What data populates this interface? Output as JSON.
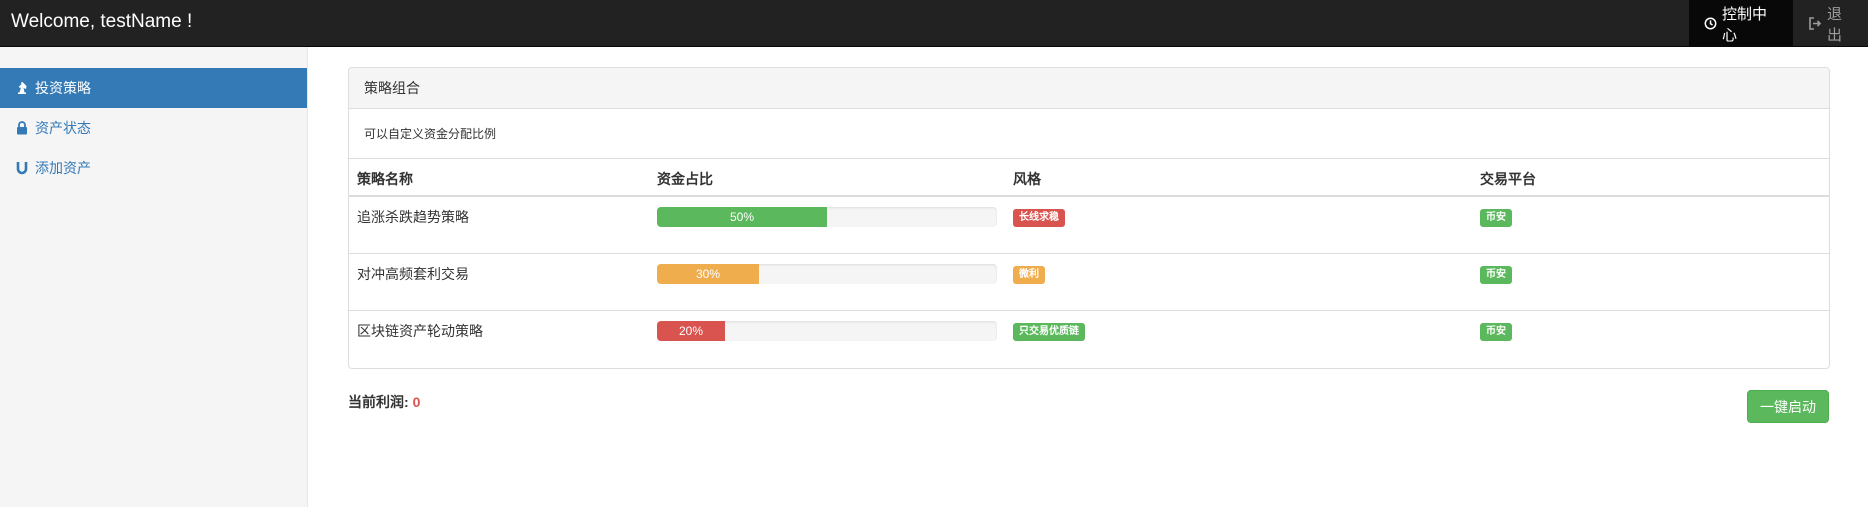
{
  "header": {
    "brand": "Welcome, testName !",
    "nav": [
      {
        "label": "控制中心",
        "icon": "dashboard-icon",
        "active": true
      },
      {
        "label": "退出",
        "icon": "logout-icon",
        "active": false
      }
    ]
  },
  "sidebar": {
    "items": [
      {
        "label": "投资策略",
        "icon": "chess-knight-icon",
        "active": true
      },
      {
        "label": "资产状态",
        "icon": "lock-icon",
        "active": false
      },
      {
        "label": "添加资产",
        "icon": "magnet-icon",
        "active": false
      }
    ]
  },
  "panel": {
    "title": "策略组合",
    "description": "可以自定义资金分配比例",
    "columns": [
      "策略名称",
      "资金占比",
      "风格",
      "交易平台"
    ],
    "rows": [
      {
        "name": "追涨杀跌趋势策略",
        "ratio": 50,
        "ratio_label": "50%",
        "ratio_color": "#5cb85c",
        "style": "长线求稳",
        "style_color": "#d9534f",
        "platform": "币安",
        "platform_color": "#5cb85c"
      },
      {
        "name": "对冲高频套利交易",
        "ratio": 30,
        "ratio_label": "30%",
        "ratio_color": "#f0ad4e",
        "style": "微利",
        "style_color": "#f0ad4e",
        "platform": "币安",
        "platform_color": "#5cb85c"
      },
      {
        "name": "区块链资产轮动策略",
        "ratio": 20,
        "ratio_label": "20%",
        "ratio_color": "#d9534f",
        "style": "只交易优质链",
        "style_color": "#5cb85c",
        "platform": "币安",
        "platform_color": "#5cb85c"
      }
    ]
  },
  "footer": {
    "profit_label": "当前利润:",
    "profit_value": "0",
    "start_button": "一键启动"
  }
}
